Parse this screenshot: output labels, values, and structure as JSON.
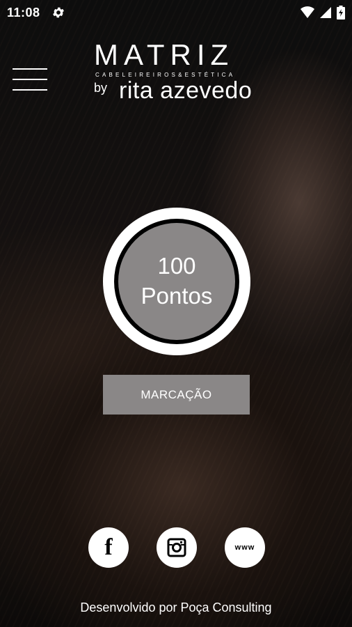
{
  "status_bar": {
    "time": "11:08",
    "icons": [
      "gear-icon",
      "wifi-icon",
      "signal-icon",
      "battery-charging-icon"
    ]
  },
  "header": {
    "menu_icon": "hamburger-menu-icon",
    "logo": {
      "main": "MATRIZ",
      "subtitle": "CABELEIREIROS&ESTÉTICA",
      "by": "by",
      "name": "rita azevedo"
    }
  },
  "points": {
    "value": "100",
    "label": "Pontos"
  },
  "actions": {
    "marcacao_label": "MARCAÇÃO"
  },
  "social": {
    "facebook_label": "f",
    "instagram_icon": "instagram-icon",
    "website_label": "www"
  },
  "footer": {
    "text": "Desenvolvido por Poça Consulting"
  },
  "colors": {
    "button_gray": "#8a8787",
    "text": "#ffffff",
    "background": "#0b0b0b"
  }
}
